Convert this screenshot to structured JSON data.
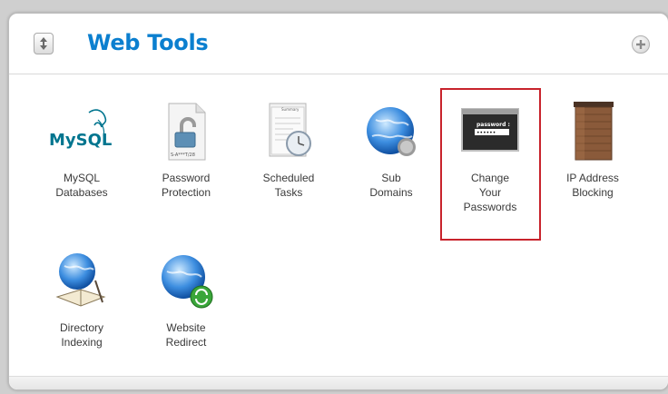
{
  "panel": {
    "title": "Web Tools"
  },
  "tools": [
    {
      "label": "MySQL\nDatabases",
      "icon": "mysql-logo-icon"
    },
    {
      "label": "Password\nProtection",
      "icon": "padlock-document-icon"
    },
    {
      "label": "Scheduled\nTasks",
      "icon": "schedule-clock-icon"
    },
    {
      "label": "Sub\nDomains",
      "icon": "globe-icon"
    },
    {
      "label": "Change\nYour\nPasswords",
      "icon": "password-window-icon",
      "highlighted": true
    },
    {
      "label": "IP Address\nBlocking",
      "icon": "brick-wall-icon"
    },
    {
      "label": "Directory\nIndexing",
      "icon": "globe-book-icon"
    },
    {
      "label": "Website\nRedirect",
      "icon": "globe-redirect-icon"
    }
  ],
  "icons": {
    "mysql_text": "MySQL",
    "password_prompt": "password :",
    "password_mask": "••••••",
    "document_caption": "S-A***T/28",
    "schedule_caption": "Summary"
  },
  "colors": {
    "title": "#0b7fcf",
    "highlight_border": "#c8232c",
    "mysql_blue": "#00758f",
    "mysql_orange": "#f29111"
  }
}
